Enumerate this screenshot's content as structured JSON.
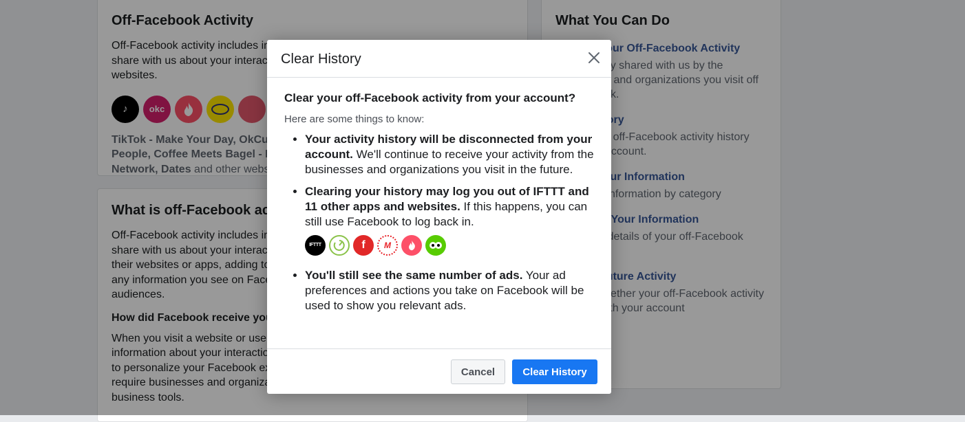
{
  "background": {
    "card1": {
      "title": "Off-Facebook Activity",
      "text": "Off-Facebook activity includes information that businesses and organizations share with us about your interactions with them, such as visiting their apps or websites.",
      "apps_text_bold": "TikTok - Make Your Day, OkCupid, Tinder, MercadoLibre, Tinder - Dating New People, Coffee Meets Bagel - Dating App, Bumble: Date, Meet Friends, Network, Dates",
      "apps_text_rest": " and other websites or apps"
    },
    "card2": {
      "title": "What is off-Facebook activity?",
      "text": "Off-Facebook activity includes information that businesses and organizations share with us about your interactions with them. Examples are things like visiting their websites or apps, adding to cart, etc. Off-Facebook activity does not include any information you see on Facebook used to show a unique group of custom audiences.",
      "subheading": "How did Facebook receive your off-Facebook activity?",
      "text2": "When you visit a website or use an app, businesses and organizations can share information about your interactions using our business tools. We use this activity to personalize your Facebook experience and show you relevant ads. We also require businesses and organizations to provide notice to people before using our business tools."
    },
    "card3": {
      "title": "What You Can Do",
      "actions": [
        {
          "link": "Manage Your Off-Facebook Activity",
          "desc": "View activity shared with us by the businesses and organizations you visit off of Facebook."
        },
        {
          "link": "Clear History",
          "desc": "Disconnect off-Facebook activity history from your account."
        },
        {
          "link": "Access Your Information",
          "desc": "View your information by category"
        },
        {
          "link": "Download Your Information",
          "desc": "Download details of your off-Facebook activity"
        },
        {
          "link": "Manage Future Activity",
          "desc": "Choose whether your off-Facebook activity is saved with your account"
        }
      ]
    }
  },
  "modal": {
    "title": "Clear History",
    "question": "Clear your off-Facebook activity from your account?",
    "intro": "Here are some things to know:",
    "points": [
      {
        "bold": "Your activity history will be disconnected from your account.",
        "rest": " We'll continue to receive your activity from the businesses and organizations you visit in the future."
      },
      {
        "bold": "Clearing your history may log you out of IFTTT and 11 other apps and websites.",
        "rest": " If this happens, you can still use Facebook to log back in."
      },
      {
        "bold": "You'll still see the same number of ads.",
        "rest": " Your ad preferences and actions you take on Facebook will be used to show you relevant ads."
      }
    ],
    "mini_icons": [
      {
        "name": "ifttt-icon",
        "label": "IFTTT",
        "color": "#000000"
      },
      {
        "name": "timer-app-icon",
        "label": "",
        "color": "#8bc34a"
      },
      {
        "name": "flipboard-icon",
        "label": "f",
        "color": "#e12828"
      },
      {
        "name": "marvel-app-icon",
        "label": "M",
        "color": "#e8242a"
      },
      {
        "name": "tinder-icon",
        "label": "",
        "color": "#fd5068"
      },
      {
        "name": "duolingo-icon",
        "label": "",
        "color": "#58cc02"
      }
    ],
    "cancel_label": "Cancel",
    "clear_label": "Clear History"
  },
  "background_app_icons": [
    {
      "name": "tiktok-icon",
      "label": "♪",
      "color": "#000000"
    },
    {
      "name": "okcupid-icon",
      "label": "okc",
      "color": "#d6206d"
    },
    {
      "name": "tinder-icon",
      "label": "",
      "color": "#fd5068"
    },
    {
      "name": "mercadolibre-icon",
      "label": "",
      "color": "#ffe600"
    },
    {
      "name": "coffee-meets-bagel-icon",
      "label": "",
      "color": "#e3576b"
    }
  ]
}
